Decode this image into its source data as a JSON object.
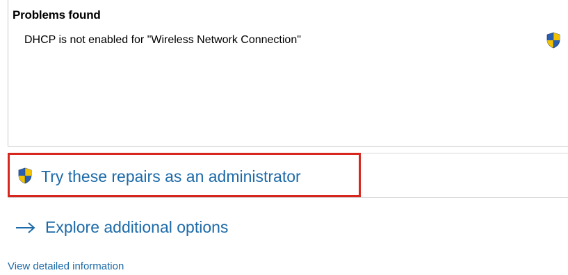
{
  "problems": {
    "title": "Problems found",
    "items": [
      {
        "text": "DHCP is not enabled for \"Wireless Network Connection\"",
        "icon": "uac-shield-icon"
      }
    ]
  },
  "actions": {
    "repair_label": "Try these repairs as an administrator",
    "repair_icon": "uac-shield-icon",
    "explore_label": "Explore additional options",
    "explore_icon": "arrow-right-icon",
    "detail_link": "View detailed information"
  },
  "colors": {
    "link": "#1c6aa8",
    "highlight": "#d7261e",
    "shield_blue": "#2a5fb0",
    "shield_yellow": "#f2c200"
  }
}
